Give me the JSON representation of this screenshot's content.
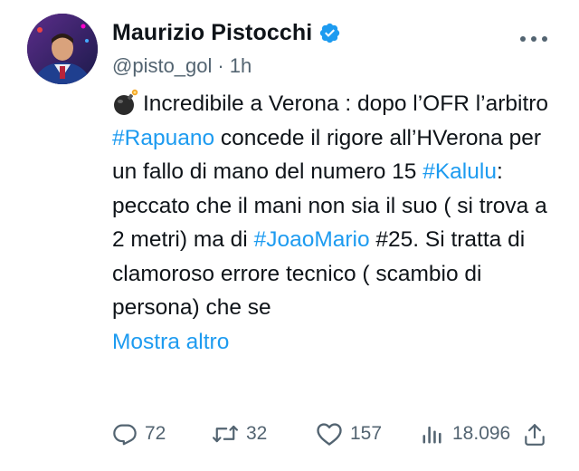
{
  "author": {
    "display_name": "Maurizio Pistocchi",
    "handle": "@pisto_gol",
    "separator": "·",
    "time": "1h"
  },
  "tweet": {
    "seg1": "Incredibile a Verona : dopo l’OFR l’arbitro ",
    "tag_rapuano": "#Rapuano",
    "seg2": " concede il rigore all’HVerona per un fallo di mano del numero 15 ",
    "tag_kalulu": "#Kalulu",
    "seg3": ": peccato che il mani non sia il suo ( si trova a 2 metri) ma di ",
    "tag_joaomario": "#JoaoMario",
    "seg4": " #25. Si tratta di clamoroso errore tecnico ( scambio di persona) che se",
    "show_more": "Mostra altro"
  },
  "actions": {
    "replies": "72",
    "reposts": "32",
    "likes": "157",
    "views": "18.096"
  },
  "icons": {
    "verified": "verified-badge-icon",
    "more": "more-dots-icon",
    "bomb": "bomb-emoji-icon",
    "reply": "reply-icon",
    "repost": "repost-icon",
    "like": "heart-icon",
    "views": "views-chart-icon",
    "share": "share-icon"
  },
  "colors": {
    "accent": "#1d9bf0",
    "text": "#0f1419",
    "muted": "#536471"
  }
}
